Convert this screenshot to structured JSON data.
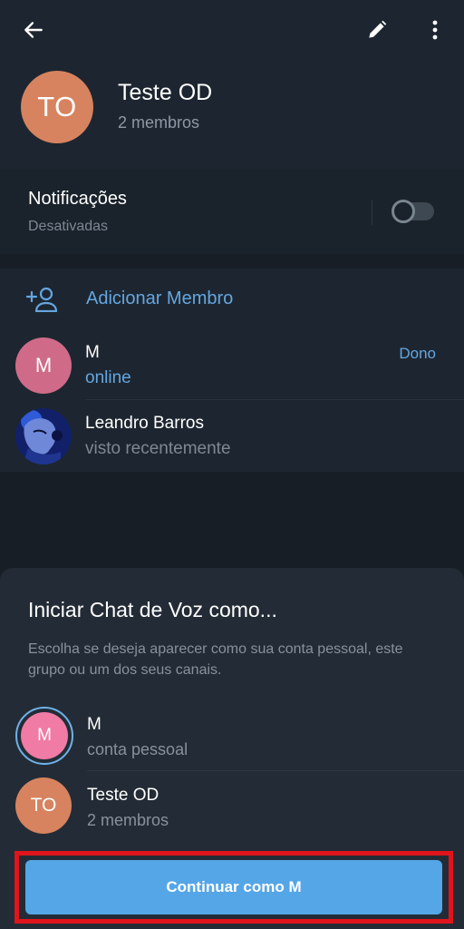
{
  "header": {
    "back_icon": "arrow-left-icon",
    "edit_icon": "pencil-icon",
    "more_icon": "more-vertical-icon",
    "avatar_initials": "TO",
    "title": "Teste OD",
    "subtitle": "2 membros"
  },
  "notifications": {
    "title": "Notificações",
    "subtitle": "Desativadas",
    "toggle_on": false
  },
  "members": {
    "add_label": "Adicionar Membro",
    "add_icon": "add-user-icon",
    "list": [
      {
        "initials": "M",
        "name": "M",
        "status": "online",
        "role": "Dono"
      },
      {
        "initials": "",
        "name": "Leandro Barros",
        "status": "visto recentemente",
        "role": ""
      }
    ]
  },
  "voice_chat_sheet": {
    "title": "Iniciar Chat de Voz como...",
    "description": "Escolha se deseja aparecer como sua conta pessoal, este grupo ou um dos seus canais.",
    "options": [
      {
        "initials": "M",
        "name": "M",
        "subtitle": "conta pessoal",
        "selected": true
      },
      {
        "initials": "TO",
        "name": "Teste OD",
        "subtitle": "2 membros",
        "selected": false
      }
    ],
    "continue_label": "Continuar como M"
  },
  "colors": {
    "accent": "#64a6e0",
    "button": "#55a6e7",
    "highlight_border": "#e1141c",
    "group_avatar": "#d7835f",
    "member_avatar": "#cf6b88"
  }
}
